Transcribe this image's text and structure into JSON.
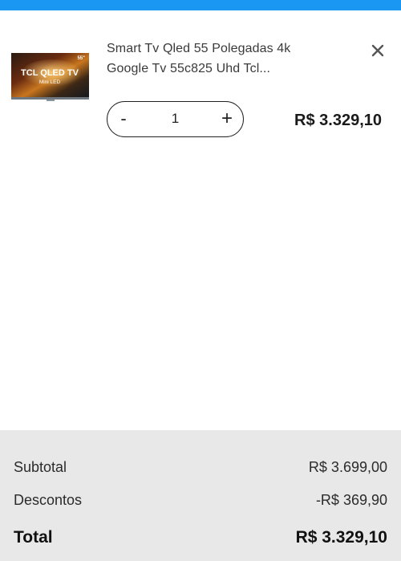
{
  "colors": {
    "top_bar": "#1a97f2",
    "summary_bg": "#e8e8e8",
    "text": "#2b2b2b"
  },
  "cart_item": {
    "title_line1": "Smart Tv Qled 55 Polegadas 4k",
    "title_line2": "Google Tv 55c825 Uhd Tcl...",
    "thumbnail": {
      "icon": "tv-product-image",
      "brand_text": "TCL QLED TV",
      "sub_text": "Mini LED",
      "size_badge": "55\""
    },
    "remove_icon": "close-icon",
    "quantity": {
      "minus_label": "-",
      "value": "1",
      "plus_label": "+"
    },
    "price": "R$ 3.329,10"
  },
  "summary": {
    "subtotal_label": "Subtotal",
    "subtotal_value": "R$ 3.699,00",
    "discount_label": "Descontos",
    "discount_value": "-R$ 369,90",
    "total_label": "Total",
    "total_value": "R$ 3.329,10"
  }
}
